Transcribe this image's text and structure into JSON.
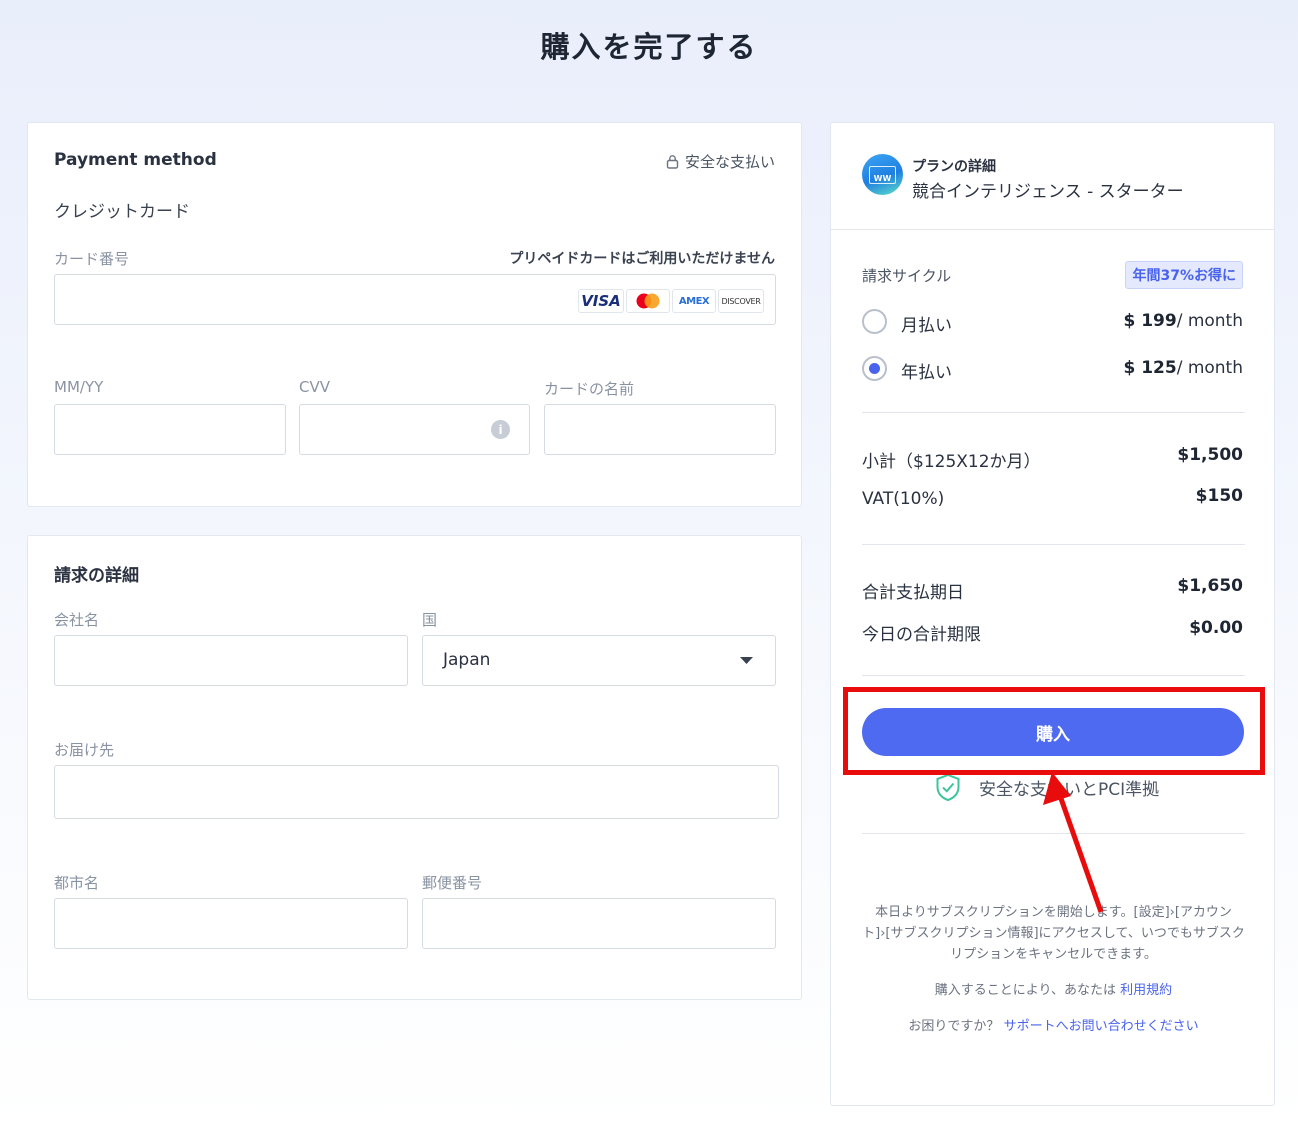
{
  "page": {
    "title": "購入を完了する"
  },
  "payment": {
    "heading": "Payment method",
    "secure_label": "安全な支払い",
    "method": "クレジットカード",
    "card_number_label": "カード番号",
    "prepaid_note": "プリペイドカードはご利用いただけません",
    "card_number_value": "",
    "card_brands": [
      "VISA",
      "mastercard",
      "AMEX",
      "DISCOVER"
    ],
    "expiry_label": "MM/YY",
    "cvv_label": "CVV",
    "card_name_label": "カードの名前"
  },
  "billing": {
    "heading": "請求の詳細",
    "company_label": "会社名",
    "country_label": "国",
    "country_value": "Japan",
    "address_label": "お届け先",
    "city_label": "都市名",
    "postal_label": "郵便番号"
  },
  "plan": {
    "heading": "プランの詳細",
    "name": "競合インテリジェンス - スターター",
    "logo_text": "WW",
    "billing_cycle_label": "請求サイクル",
    "savings_badge": "年間37%お得に",
    "options": [
      {
        "label": "月払い",
        "price": "$ 199",
        "unit": "/ month",
        "selected": false
      },
      {
        "label": "年払い",
        "price": "$ 125",
        "unit": "/ month",
        "selected": true
      }
    ],
    "subtotal_label": "小計（$125X12か月）",
    "subtotal_value": "$1,500",
    "vat_label": "VAT(10%)",
    "vat_value": "$150",
    "total_due_label": "合計支払期日",
    "total_due_value": "$1,650",
    "today_label": "今日の合計期限",
    "today_value": "$0.00",
    "buy_label": "購入",
    "secure_pci": "安全な支払いとPCI準拠",
    "info_text": "本日よりサブスクリプションを開始します。[設定]›[アカウント]›[サブスクリプション情報]にアクセスして、いつでもサブスクリプションをキャンセルできます。",
    "terms_prefix": "購入することにより、あなたは",
    "terms_link": "利用規約",
    "help_prefix": "お困りですか？",
    "help_link": "サポートへお問い合わせください"
  },
  "colors": {
    "accent": "#4e6af0",
    "highlight": "#e80c0c",
    "badge_bg": "#e4e9fd"
  }
}
